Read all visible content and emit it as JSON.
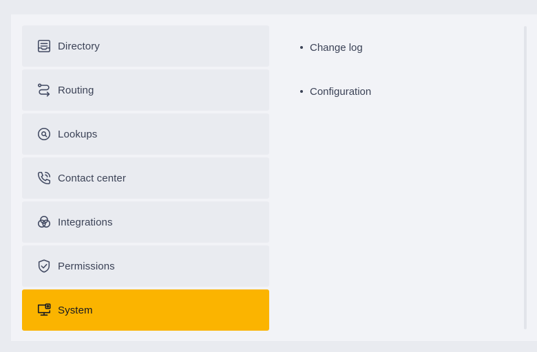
{
  "menu": {
    "items": [
      {
        "label": "Directory",
        "icon": "directory-icon"
      },
      {
        "label": "Routing",
        "icon": "routing-icon"
      },
      {
        "label": "Lookups",
        "icon": "lookups-icon"
      },
      {
        "label": "Contact center",
        "icon": "contact-center-icon"
      },
      {
        "label": "Integrations",
        "icon": "integrations-icon"
      },
      {
        "label": "Permissions",
        "icon": "permissions-icon"
      },
      {
        "label": "System",
        "icon": "system-icon",
        "active": true
      }
    ]
  },
  "submenu": {
    "items": [
      {
        "label": "Change log"
      },
      {
        "label": "Configuration"
      }
    ]
  },
  "colors": {
    "active_background": "#fbb400",
    "item_background": "#e9ebf0",
    "panel_background": "#f2f3f7",
    "text": "#3b4256"
  }
}
